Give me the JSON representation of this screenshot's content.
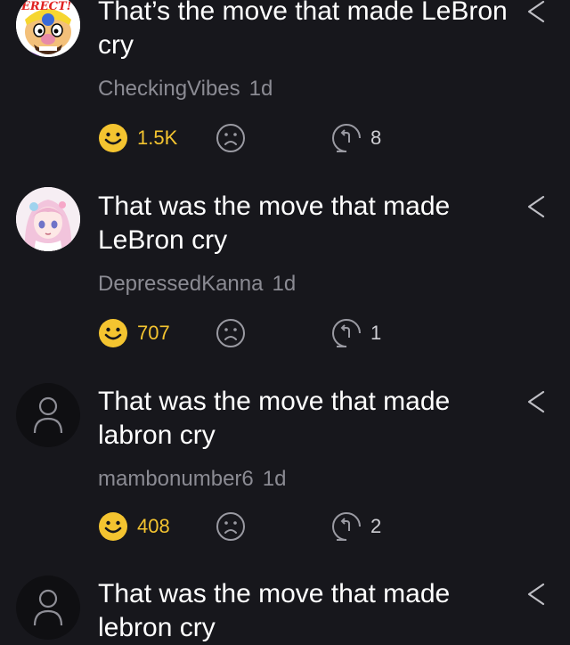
{
  "comments": [
    {
      "text": "That’s the move that made LeBron cry",
      "username": "CheckingVibes",
      "time": "1d",
      "likes": "1.5K",
      "replies": "8",
      "avatar": "wario-avatar",
      "avatar_text": "ERECT!"
    },
    {
      "text": "That was the move that made LeBron cry",
      "username": "DepressedKanna",
      "time": "1d",
      "likes": "707",
      "replies": "1",
      "avatar": "anime-girl-avatar"
    },
    {
      "text": "That was the move that made labron cry",
      "username": "mambonumber6",
      "time": "1d",
      "likes": "408",
      "replies": "2",
      "avatar": "default-user-avatar"
    },
    {
      "text": "That was the move that made lebron cry",
      "avatar": "default-user-avatar"
    }
  ],
  "colors": {
    "background": "#17171c",
    "like_accent": "#f4c430",
    "meta_text": "#8b8b93"
  }
}
